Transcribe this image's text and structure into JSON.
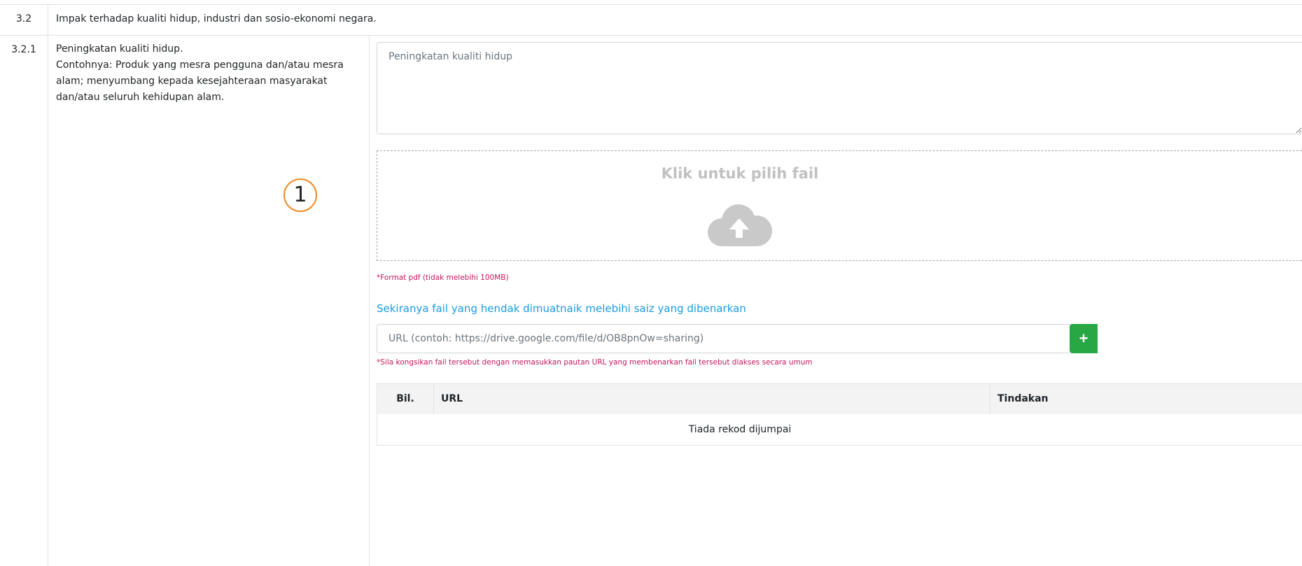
{
  "section": {
    "number": "3.2",
    "title": "Impak terhadap kualiti hidup, industri dan sosio-ekonomi negara."
  },
  "item": {
    "number": "3.2.1",
    "lines": [
      "Peningkatan kualiti hidup.",
      "Contohnya: Produk yang mesra pengguna dan/atau mesra",
      "alam; menyumbang kepada  kesejahteraan masyarakat",
      "dan/atau seluruh kehidupan alam."
    ]
  },
  "answer": {
    "placeholder": "Peningkatan kualiti hidup"
  },
  "upload": {
    "title": "Klik untuk pilih fail",
    "icon": "cloud-upload-icon",
    "format_note": "*Format pdf (tidak melebihi 100MB)"
  },
  "url_section": {
    "hint": "Sekiranya fail yang hendak dimuatnaik melebihi saiz yang dibenarkan",
    "placeholder": "URL (contoh: https://drive.google.com/file/d/OB8pnOw=sharing)",
    "add_label": "+",
    "share_note": "*Sila kongsikan fail tersebut dengan memasukkan pautan URL yang membenarkan fail tersebut diakses secara umum"
  },
  "url_table": {
    "columns": [
      "Bil.",
      "URL",
      "Tindakan"
    ],
    "empty_text": "Tiada rekod dijumpai",
    "rows": []
  },
  "annotation": {
    "label": "1"
  },
  "colors": {
    "accent_link": "#1a9be0",
    "note_red": "#c2185b",
    "add_green": "#28a745",
    "marker_orange": "#f08a24"
  }
}
